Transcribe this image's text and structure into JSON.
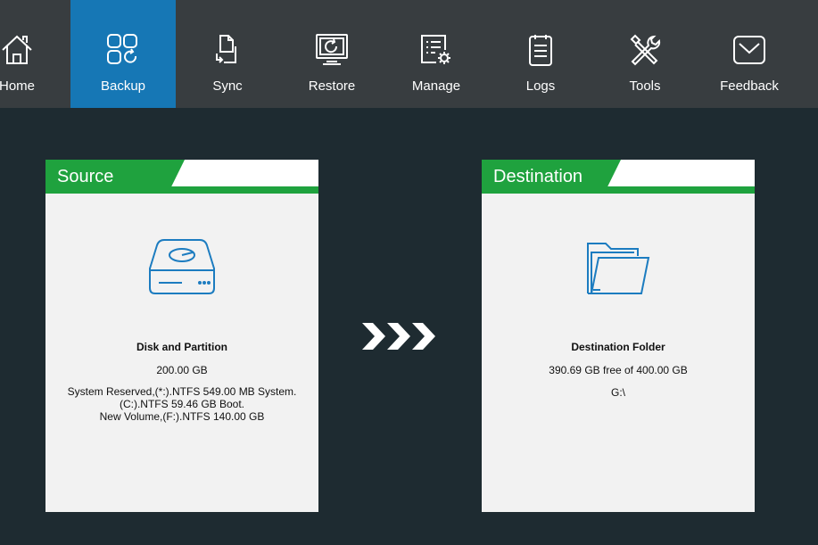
{
  "toolbar": {
    "items": [
      {
        "label": "Home",
        "icon": "home-icon"
      },
      {
        "label": "Backup",
        "icon": "backup-icon",
        "active": true
      },
      {
        "label": "Sync",
        "icon": "sync-icon"
      },
      {
        "label": "Restore",
        "icon": "restore-icon"
      },
      {
        "label": "Manage",
        "icon": "manage-icon"
      },
      {
        "label": "Logs",
        "icon": "logs-icon"
      },
      {
        "label": "Tools",
        "icon": "tools-icon"
      },
      {
        "label": "Feedback",
        "icon": "feedback-icon"
      }
    ]
  },
  "source": {
    "title": "Source",
    "icon": "hard-disk-icon",
    "name": "Disk and Partition",
    "size": "200.00 GB",
    "details": "System Reserved,(*:).NTFS 549.00 MB System.\n(C:).NTFS 59.46 GB Boot.\nNew Volume,(F:).NTFS 140.00 GB"
  },
  "arrows": {
    "icon": "triple-chevron-right-icon"
  },
  "destination": {
    "title": "Destination",
    "icon": "folder-icon",
    "name": "Destination Folder",
    "free": "390.69 GB free of 400.00 GB",
    "path": "G:\\"
  },
  "colors": {
    "background": "#1e2b31",
    "toolbar": "#383d40",
    "active_tab": "#1677b5",
    "card_header": "#1fa23e",
    "card": "#f2f2f2",
    "icon_blue": "#1c7cc0"
  }
}
